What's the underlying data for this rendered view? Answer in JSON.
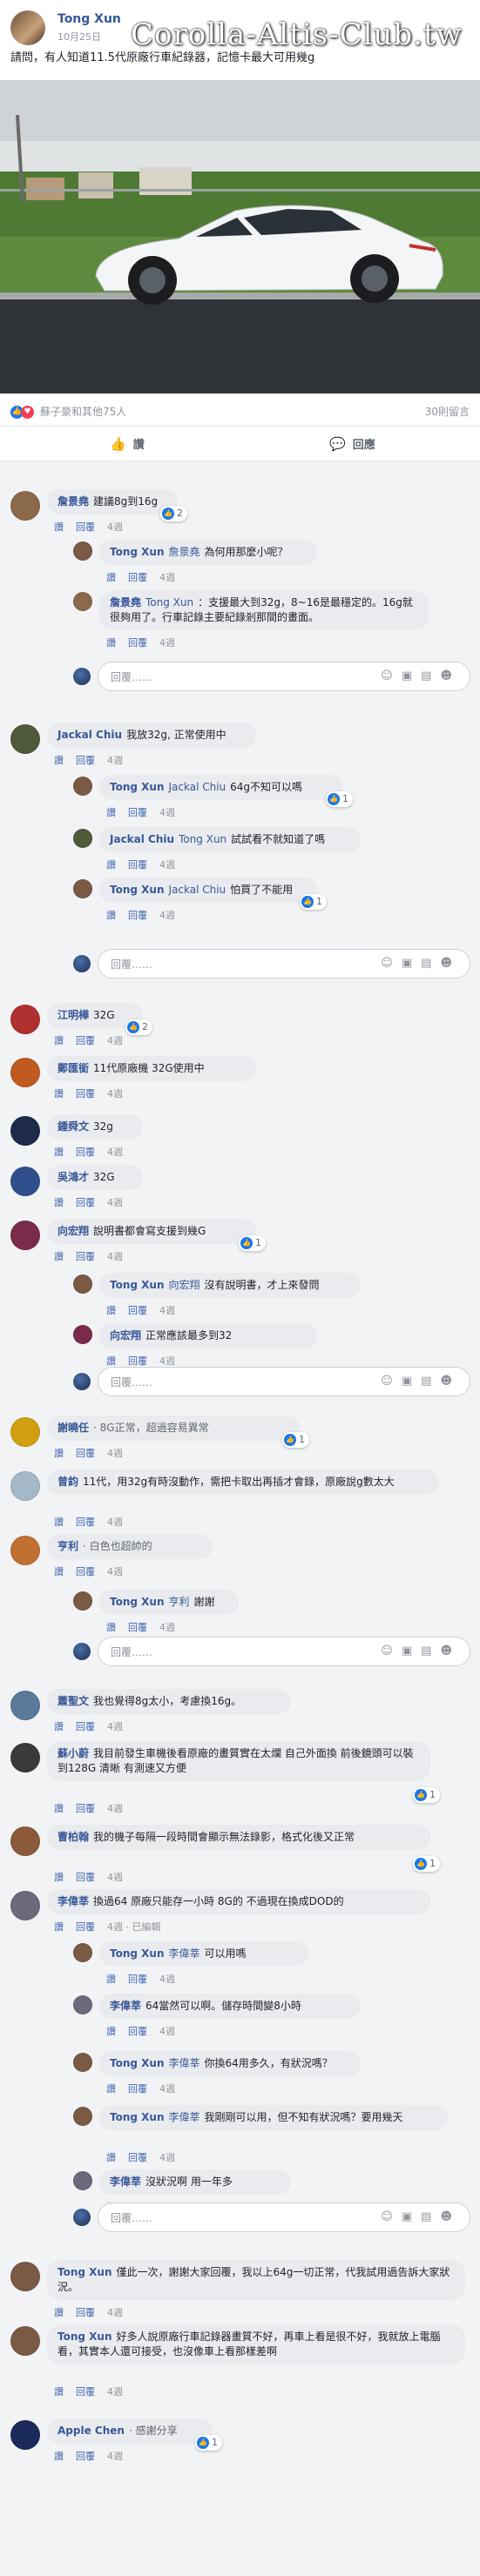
{
  "post": {
    "author": "Tong Xun",
    "date": "10月25日",
    "watermark": "Corolla-Altis-Club.tw",
    "text": "請問，有人知道11.5代原廠行車紀錄器，記憶卡最大可用幾g"
  },
  "stats": {
    "likers": "蘇子豪和其他75人",
    "comments": "30則留言"
  },
  "actions": {
    "like": "讚",
    "comment": "回應"
  },
  "labels": {
    "like": "讚",
    "reply": "回覆",
    "write": "回覆……",
    "edited": "· 已編輯"
  },
  "colors": {
    "accent": "#365899",
    "like": "#1877f2",
    "bubble": "#e9ebee",
    "bg": "#f2f3f5"
  },
  "comments": [
    {
      "name": "詹景堯",
      "text": "建議8g到16g",
      "time": "4週",
      "reactions": "2",
      "avatar": "#8a6a4a"
    },
    {
      "name": "Tong Xun",
      "tag": "詹景堯",
      "text": "為何用那麼小呢？",
      "time": "4週",
      "avatar": "#7a5a44"
    },
    {
      "name": "詹景堯",
      "tag": "Tong Xun",
      "text": "：支援最大到32g，8~16是最穩定的。16g就很夠用了。行車記錄主要紀錄剎那間的畫面。",
      "time": "4週",
      "avatar": "#8a6a4a"
    },
    {
      "name": "Jackal Chiu",
      "text": "我放32g, 正常使用中",
      "time": "4週",
      "avatar": "#4e5a3a"
    },
    {
      "name": "Tong Xun",
      "tag": "Jackal Chiu",
      "text": "64g不知可以嗎",
      "time": "4週",
      "reactions": "1",
      "avatar": "#7a5a44"
    },
    {
      "name": "Jackal Chiu",
      "tag": "Tong Xun",
      "text": "試試看不就知道了嗎",
      "time": "4週",
      "avatar": "#4e5a3a"
    },
    {
      "name": "Tong Xun",
      "tag": "Jackal Chiu",
      "text": "怕買了不能用",
      "time": "4週",
      "reactions": "1",
      "avatar": "#7a5a44"
    },
    {
      "name": "江明樺",
      "text": "32G",
      "time": "4週",
      "reactions": "2",
      "avatar": "#b03030"
    },
    {
      "name": "鄭匯銜",
      "text": "11代原廠機 32G使用中",
      "time": "4週",
      "avatar": "#c05a20"
    },
    {
      "name": "鍾舜文",
      "text": "32g",
      "time": "4週",
      "avatar": "#1d2a4a"
    },
    {
      "name": "吳鴻才",
      "text": "32G",
      "time": "4週",
      "avatar": "#2e4f8a"
    },
    {
      "name": "向宏翔",
      "text": "說明書都會寫支援到幾G",
      "time": "4週",
      "reactions": "1",
      "avatar": "#7a2a4a"
    },
    {
      "name": "Tong Xun",
      "tag": "向宏翔",
      "text": "沒有說明書，才上來發問",
      "time": "4週",
      "avatar": "#7a5a44"
    },
    {
      "name": "向宏翔",
      "text": "正常應該最多到32",
      "time": "4週",
      "avatar": "#7a2a4a"
    },
    {
      "name": "謝曉任",
      "status": "8G正常，超過容易異常",
      "time": "4週",
      "reactions": "1",
      "avatar": "#d0a010"
    },
    {
      "name": "曾鈞",
      "text": "11代，用32g有時沒動作，需把卡取出再插才會錄，原廠說g數太大",
      "time": "4週",
      "avatar": "#a4b8c8"
    },
    {
      "name": "亨利",
      "status": "白色也超帥的",
      "time": "4週",
      "avatar": "#c07030"
    },
    {
      "name": "Tong Xun",
      "tag": "亨利",
      "text": "謝謝",
      "time": "4週",
      "avatar": "#7a5a44"
    },
    {
      "name": "蕭聖文",
      "text": "我也覺得8g太小，考慮換16g。",
      "time": "4週",
      "avatar": "#5a7a9a"
    },
    {
      "name": "蘇小蔚",
      "text": "我目前發生車機後看原廠的畫質實在太爛 自己外面換 前後鏡頭可以裝到128G 清晰 有測速又方便",
      "time": "4週",
      "reactions": "1",
      "avatar": "#3a3a3a"
    },
    {
      "name": "曹柏翰",
      "text": "我的機子每隔一段時間會顯示無法錄影，格式化後又正常",
      "time": "4週",
      "reactions": "1",
      "avatar": "#8a5a3a"
    },
    {
      "name": "李偉莘",
      "text": "換過64 原廠只能存一小時 8G的 不過現在換成DOD的",
      "time": "4週",
      "edited": true,
      "avatar": "#6a6a7a"
    },
    {
      "name": "Tong Xun",
      "tag": "李偉莘",
      "text": "可以用嗎",
      "time": "4週",
      "avatar": "#7a5a44"
    },
    {
      "name": "李偉莘",
      "text": "64當然可以啊。儲存時間變8小時",
      "time": "4週",
      "avatar": "#6a6a7a"
    },
    {
      "name": "Tong Xun",
      "tag": "李偉莘",
      "text": "你換64用多久，有狀況嗎？",
      "time": "4週",
      "avatar": "#7a5a44"
    },
    {
      "name": "Tong Xun",
      "tag": "李偉莘",
      "text": "我剛剛可以用，但不知有狀況嗎？要用幾天",
      "time": "4週",
      "avatar": "#7a5a44"
    },
    {
      "name": "李偉莘",
      "text": "沒狀況啊 用一年多",
      "time": "4週",
      "avatar": "#6a6a7a"
    },
    {
      "name": "Tong Xun",
      "text": "僅此一次，謝謝大家回覆，我以上64g一切正常，代我試用過告訴大家狀況。",
      "time": "4週",
      "avatar": "#7a5a44"
    },
    {
      "name": "Tong Xun",
      "text": "好多人說原廠行車記錄器畫質不好，再車上看是很不好，我就放上電腦看，其實本人還可接受，也沒像車上看那樣差啊",
      "time": "4週",
      "avatar": "#7a5a44"
    },
    {
      "name": "Apple Chen",
      "status": "感謝分享",
      "time": "4週",
      "reactions": "1",
      "avatar": "#1a2a5a"
    }
  ]
}
